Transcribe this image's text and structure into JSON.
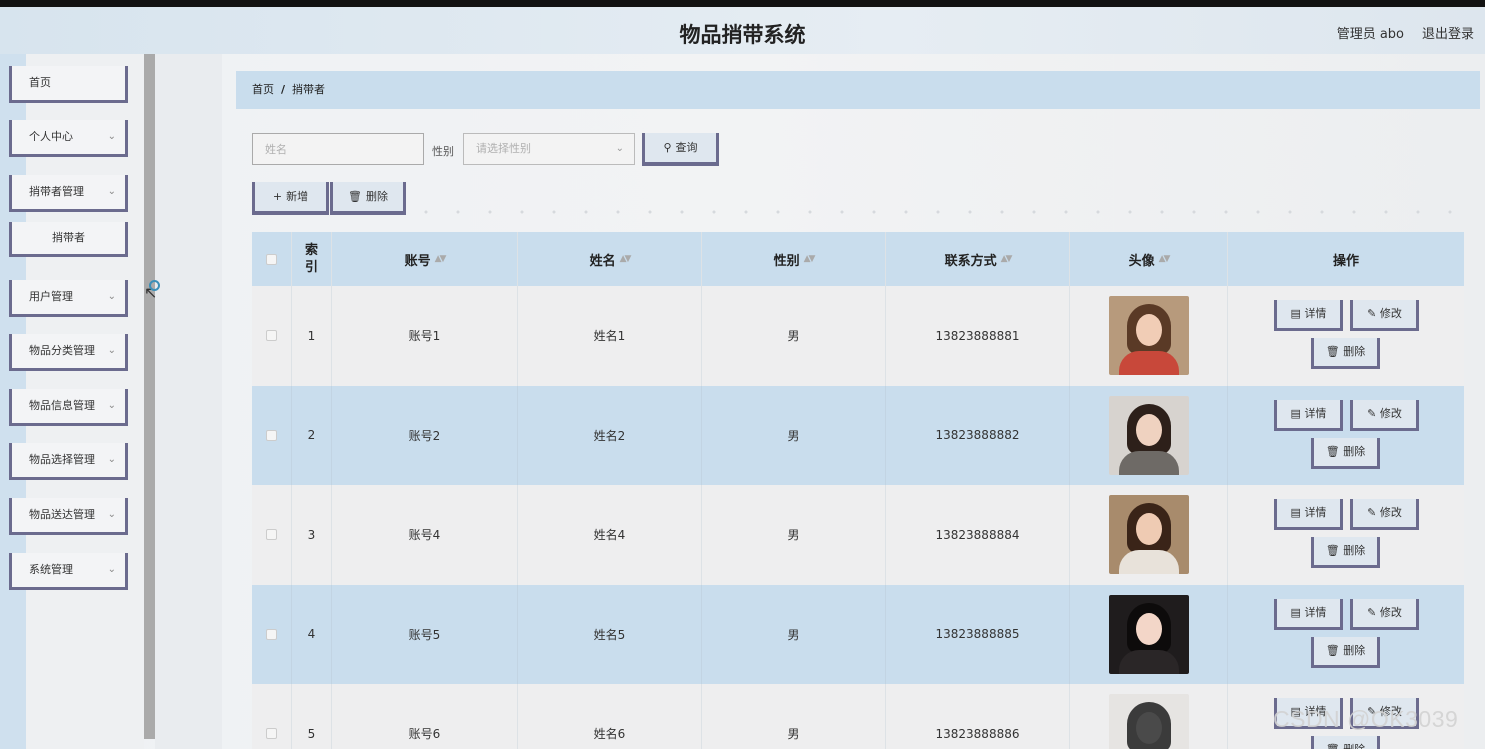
{
  "header": {
    "title": "物品捎带系统",
    "user": "管理员 abo",
    "logout": "退出登录"
  },
  "sidebar": {
    "items": [
      {
        "label": "首页",
        "has_arrow": false
      },
      {
        "label": "个人中心",
        "has_arrow": true
      },
      {
        "label": "捎带者管理",
        "has_arrow": true
      },
      {
        "label": "捎带者",
        "sub": true
      },
      {
        "label": "用户管理",
        "has_arrow": true
      },
      {
        "label": "物品分类管理",
        "has_arrow": true
      },
      {
        "label": "物品信息管理",
        "has_arrow": true
      },
      {
        "label": "物品选择管理",
        "has_arrow": true
      },
      {
        "label": "物品送达管理",
        "has_arrow": true
      },
      {
        "label": "系统管理",
        "has_arrow": true
      }
    ]
  },
  "breadcrumb": {
    "home": "首页",
    "separator": "/",
    "current": "捎带者"
  },
  "search": {
    "name_placeholder": "姓名",
    "gender_label": "性别",
    "gender_placeholder": "请选择性别",
    "query_button": "查询"
  },
  "actions": {
    "add": "新增",
    "delete": "删除"
  },
  "table": {
    "columns": {
      "index": "索引",
      "account": "账号",
      "name": "姓名",
      "gender": "性别",
      "contact": "联系方式",
      "avatar": "头像",
      "ops": "操作"
    },
    "row_buttons": {
      "detail": "详情",
      "edit": "修改",
      "delete": "删除"
    },
    "rows": [
      {
        "index": "1",
        "account": "账号1",
        "name": "姓名1",
        "gender": "男",
        "contact": "13823888881"
      },
      {
        "index": "2",
        "account": "账号2",
        "name": "姓名2",
        "gender": "男",
        "contact": "13823888882"
      },
      {
        "index": "3",
        "account": "账号4",
        "name": "姓名4",
        "gender": "男",
        "contact": "13823888884"
      },
      {
        "index": "4",
        "account": "账号5",
        "name": "姓名5",
        "gender": "男",
        "contact": "13823888885"
      },
      {
        "index": "5",
        "account": "账号6",
        "name": "姓名6",
        "gender": "男",
        "contact": "13823888886"
      }
    ]
  },
  "watermark": "CSDN @OK3039",
  "icons": {
    "search": "search-icon",
    "add": "plus-icon",
    "delete": "trash-icon",
    "detail": "document-icon",
    "edit": "pencil-icon",
    "chevron": "chevron-down-icon"
  }
}
